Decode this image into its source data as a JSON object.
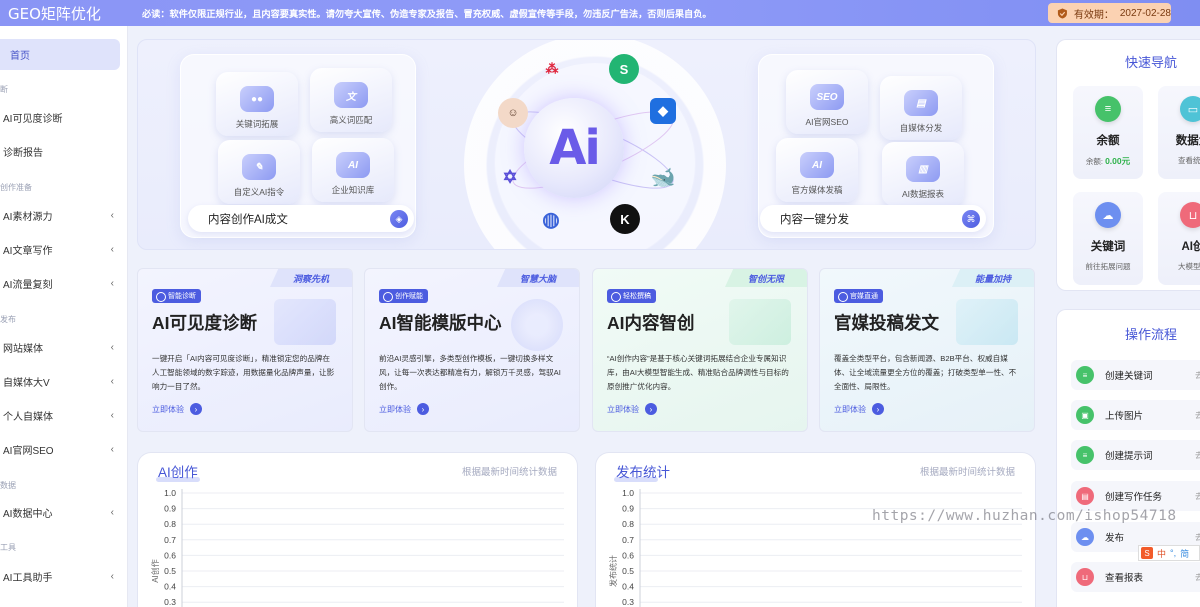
{
  "topbar": {
    "brand": "GEO矩阵优化",
    "notice": "必读：软件仅限正规行业，且内容要真实性。请勿夸大宣传、伪造专家及报告、冒充权威、虚假宣传等手段，勿违反广告法，否则后果自负。",
    "expiry_label": "有效期：",
    "expiry_date": "2027-02-28"
  },
  "sidebar": {
    "home": "首页",
    "groups": [
      "断",
      "创作准备",
      "发布",
      "数据",
      "工具"
    ],
    "items": [
      {
        "label": "AI可见度诊断",
        "chevron": false
      },
      {
        "label": "诊断报告",
        "chevron": false
      },
      {
        "label": "AI素材源力",
        "chevron": true
      },
      {
        "label": "AI文章写作",
        "chevron": true
      },
      {
        "label": "AI流量复刻",
        "chevron": true
      },
      {
        "label": "网站媒体",
        "chevron": true
      },
      {
        "label": "自媒体大V",
        "chevron": true
      },
      {
        "label": "个人自媒体",
        "chevron": true
      },
      {
        "label": "AI官网SEO",
        "chevron": true
      },
      {
        "label": "AI数据中心",
        "chevron": true
      },
      {
        "label": "AI工具助手",
        "chevron": true
      }
    ]
  },
  "hero": {
    "left_tiles": [
      "关键词拓展",
      "高义词匹配",
      "自定义AI指令",
      "企业知识库"
    ],
    "left_pill": "内容创作AI成文",
    "core_text": "Ai",
    "right_tiles": [
      "AI官网SEO",
      "自媒体分发",
      "官方媒体发稿",
      "AI数据报表"
    ],
    "right_pill": "内容一键分发",
    "tile_badges": [
      "SEO",
      "AI"
    ]
  },
  "features": [
    {
      "ribbon": "洞察先机",
      "tag": "智能诊断",
      "title": "AI可见度诊断",
      "desc": "一键开启「AI内容可见度诊断」，精准锁定您的品牌在人工智能领域的数字踪迹，用数据量化品牌声量，让影响力一目了然。",
      "link": "立即体验",
      "color": "#4c5ce0",
      "ribbon_bg": "#dfe3fb",
      "bg": "linear-gradient(160deg,#f3f4fe 0%,#e9ecfd 100%)"
    },
    {
      "ribbon": "智慧大脑",
      "tag": "创作赋能",
      "title": "AI智能模版中心",
      "desc": "前沿AI灵感引擎，多类型创作模板，一键切换多样文风，让每一次表达都精准有力，解锁万千灵感，驾驭AI创作。",
      "link": "立即体验",
      "color": "#4c5ce0",
      "ribbon_bg": "#dfe3fb",
      "bg": "linear-gradient(160deg,#f3f4fe 0%,#e9ecfd 100%)"
    },
    {
      "ribbon": "智创无限",
      "tag": "轻松撰稿",
      "title": "AI内容智创",
      "desc": "“AI创作内容”是基于核心关键词拓展结合企业专属知识库，由AI大模型智能生成、精准贴合品牌调性与目标的原创推广优化内容。",
      "link": "立即体验",
      "color": "#4c5ce0",
      "ribbon_bg": "#d8f3e4",
      "bg": "linear-gradient(160deg,#f1fbf6 0%,#e6f5ef 100%)"
    },
    {
      "ribbon": "能量加持",
      "tag": "官媒直通",
      "title": "官媒投稿发文",
      "desc": "覆盖全类型平台，包含新闻源、B2B平台、权威自媒体、让全域流量更全方位的覆盖；打破类型单一性、不全面性、局限性。",
      "link": "立即体验",
      "color": "#4c5ce0",
      "ribbon_bg": "#dcf0f6",
      "bg": "linear-gradient(160deg,#f1f8fc 0%,#e6f1f8 100%)"
    }
  ],
  "charts": [
    {
      "title": "AI创作",
      "subtitle": "根据最新时间统计数据",
      "ylabel": "AI创作"
    },
    {
      "title": "发布统计",
      "subtitle": "根据最新时间统计数据",
      "ylabel": "发布统计"
    }
  ],
  "chart_data": [
    {
      "type": "line",
      "title": "AI创作",
      "xlabel": "",
      "ylabel": "AI创作",
      "ylim": [
        0,
        1.0
      ],
      "yticks": [
        "1.0",
        "0.9",
        "0.8",
        "0.7",
        "0.6",
        "0.5",
        "0.4",
        "0.3"
      ],
      "series": [],
      "grid": true
    },
    {
      "type": "line",
      "title": "发布统计",
      "xlabel": "",
      "ylabel": "发布统计",
      "ylim": [
        0,
        1.0
      ],
      "yticks": [
        "1.0",
        "0.9",
        "0.8",
        "0.7",
        "0.6",
        "0.5",
        "0.4",
        "0.3"
      ],
      "series": [],
      "grid": true
    }
  ],
  "quicknav": {
    "title": "快速导航",
    "cards": [
      {
        "label": "余额",
        "sub_prefix": "余额: ",
        "sub_value": "0.00元",
        "icon": "document-icon",
        "color": "#46c26a"
      },
      {
        "label": "数据大",
        "sub_prefix": "查看统计",
        "sub_value": "",
        "icon": "monitor-icon",
        "color": "#4fc3d6"
      },
      {
        "label": "关键词",
        "sub_prefix": "前往拓展问题",
        "sub_value": "",
        "icon": "cloud-icon",
        "color": "#6d8ff0"
      },
      {
        "label": "AI创",
        "sub_prefix": "大模型自",
        "sub_value": "",
        "icon": "basket-icon",
        "color": "#ef6a7a"
      }
    ]
  },
  "flow": {
    "title": "操作流程",
    "steps": [
      {
        "label": "创建关键词",
        "go": "去创",
        "color": "#46c26a"
      },
      {
        "label": "上传图片",
        "go": "去上",
        "color": "#46c26a"
      },
      {
        "label": "创建提示词",
        "go": "去创",
        "color": "#46c26a"
      },
      {
        "label": "创建写作任务",
        "go": "去创",
        "color": "#ef6a7a"
      },
      {
        "label": "发布",
        "go": "去发",
        "color": "#6d8ff0"
      },
      {
        "label": "查看报表",
        "go": "去查",
        "color": "#ef6a7a"
      }
    ]
  },
  "watermark": "https://www.huzhan.com/ishop54718",
  "ime": {
    "s": "S",
    "c": "中",
    "dot": "°,",
    "m": "简"
  }
}
